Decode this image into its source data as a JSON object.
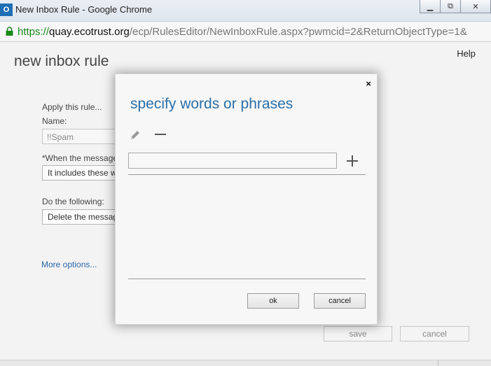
{
  "window": {
    "app_icon": "O",
    "title": "New Inbox Rule - Google Chrome",
    "controls": {
      "minimize": "▁",
      "restore": "⧉",
      "close": "✕"
    }
  },
  "address": {
    "scheme": "https://",
    "host": "quay.ecotrust.org",
    "path": "/ecp/RulesEditor/NewInboxRule.aspx?pwmcid=2&ReturnObjectType=1&"
  },
  "page": {
    "title": "new inbox rule",
    "help": "Help",
    "apply_label": "Apply this rule...",
    "name_label": "Name:",
    "name_value": "!!Spam",
    "when_label": "*When the message",
    "when_value": "It includes these w",
    "do_label": "Do the following:",
    "do_value": "Delete the messag",
    "more_options": "More options...",
    "save": "save",
    "cancel": "cancel"
  },
  "dialog": {
    "title": "specify words or phrases",
    "close": "×",
    "input_value": "",
    "ok": "ok",
    "cancel": "cancel",
    "phrases": []
  }
}
